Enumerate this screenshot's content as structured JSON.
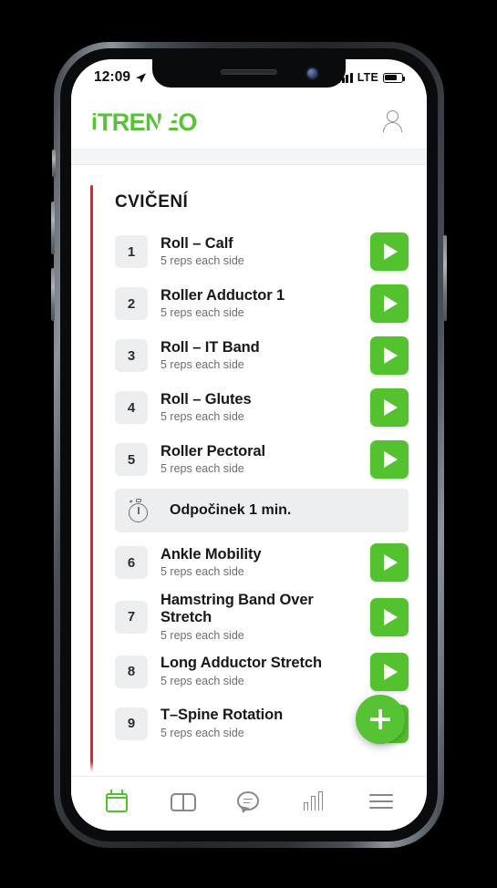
{
  "status_bar": {
    "time": "12:09",
    "location_icon": "location-arrow-icon",
    "network": "LTE",
    "signal_icon": "signal-bars-icon",
    "battery_icon": "battery-icon"
  },
  "header": {
    "logo_prefix": "i",
    "logo_part1": "TREN",
    "logo_part2": "E",
    "logo_part3": "O",
    "logo_full": "iTRENEO",
    "profile_icon": "person-icon"
  },
  "main": {
    "section_title": "CVIČENÍ",
    "rows": [
      {
        "kind": "exercise",
        "number": "1",
        "name": "Roll – Calf",
        "reps": "5 reps each side",
        "play_icon": "play-icon"
      },
      {
        "kind": "exercise",
        "number": "2",
        "name": "Roller Adductor 1",
        "reps": "5 reps each side",
        "play_icon": "play-icon"
      },
      {
        "kind": "exercise",
        "number": "3",
        "name": "Roll – IT Band",
        "reps": "5 reps each side",
        "play_icon": "play-icon"
      },
      {
        "kind": "exercise",
        "number": "4",
        "name": "Roll – Glutes",
        "reps": "5 reps each side",
        "play_icon": "play-icon"
      },
      {
        "kind": "exercise",
        "number": "5",
        "name": "Roller Pectoral",
        "reps": "5 reps each side",
        "play_icon": "play-icon"
      },
      {
        "kind": "rest",
        "label": "Odpočinek 1 min.",
        "icon": "stopwatch-icon"
      },
      {
        "kind": "exercise",
        "number": "6",
        "name": "Ankle Mobility",
        "reps": "5 reps each side",
        "play_icon": "play-icon"
      },
      {
        "kind": "exercise",
        "number": "7",
        "name": "Hamstring Band Over Stretch",
        "reps": "5 reps each side",
        "play_icon": "play-icon"
      },
      {
        "kind": "exercise",
        "number": "8",
        "name": "Long Adductor Stretch",
        "reps": "5 reps each side",
        "play_icon": "play-icon"
      },
      {
        "kind": "exercise",
        "number": "9",
        "name": "T–Spine Rotation",
        "reps": "5 reps each side",
        "play_icon": "play-icon"
      }
    ],
    "fab_icon": "plus-icon"
  },
  "bottom_nav": {
    "items": [
      {
        "name": "calendar",
        "icon": "calendar-icon",
        "active": true
      },
      {
        "name": "library",
        "icon": "book-icon",
        "active": false
      },
      {
        "name": "messages",
        "icon": "chat-icon",
        "active": false
      },
      {
        "name": "stats",
        "icon": "bar-chart-icon",
        "active": false
      },
      {
        "name": "menu",
        "icon": "hamburger-menu-icon",
        "active": false
      }
    ]
  },
  "colors": {
    "brand_green": "#56c334",
    "play_green": "#54c22f",
    "accent_red": "#e8202a",
    "badge_gray": "#eceef0",
    "text_dark": "#17181a",
    "text_muted": "#6a6e73"
  }
}
